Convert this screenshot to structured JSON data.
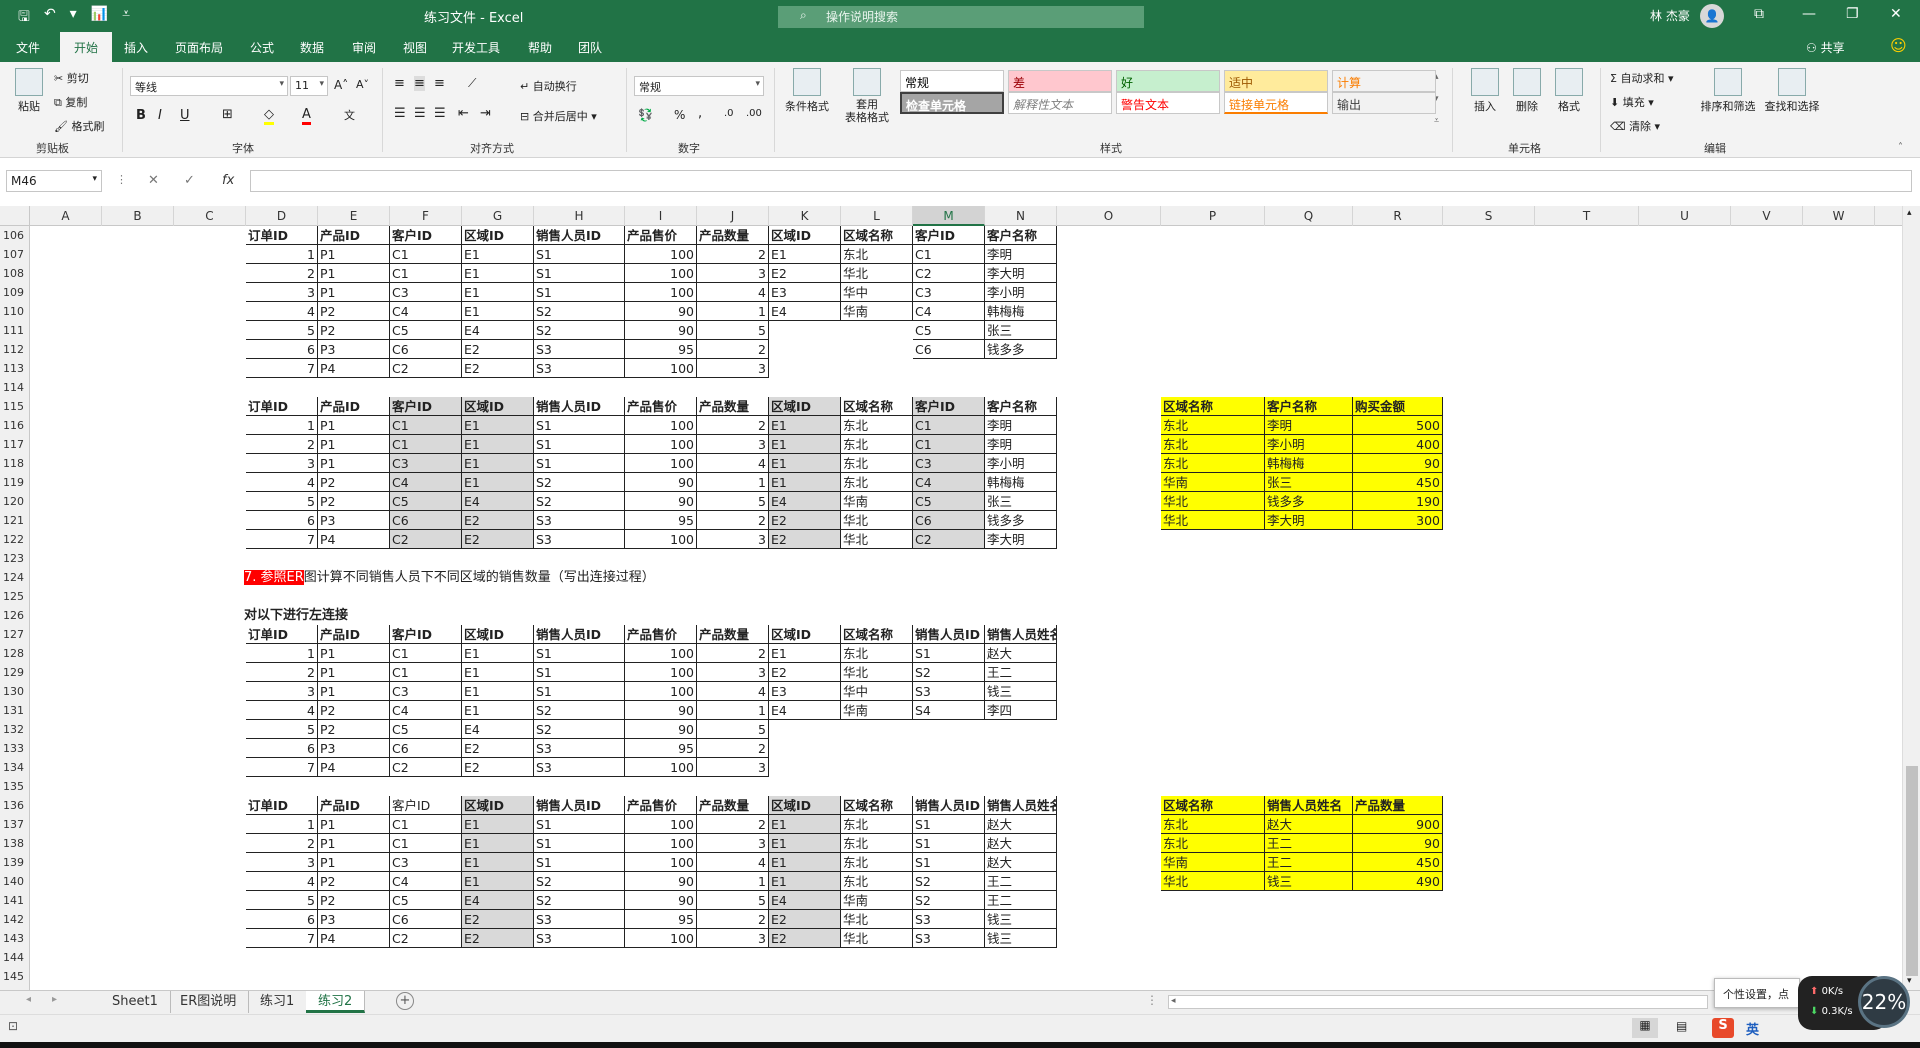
{
  "titlebar": {
    "doc_title": "练习文件 - Excel",
    "search_placeholder": "操作说明搜索",
    "user": "林 杰豪",
    "avatar_glyph": "👤",
    "qat": {
      "save": "🖫",
      "undo": "↶",
      "dropdown": "▾",
      "chart": "📊",
      "customize": "⩡"
    },
    "controls": {
      "ribbon_opts": "⧉",
      "minimize": "—",
      "restore": "❐",
      "close": "✕"
    }
  },
  "menu": {
    "tabs": [
      "文件",
      "开始",
      "插入",
      "页面布局",
      "公式",
      "数据",
      "审阅",
      "视图",
      "开发工具",
      "帮助",
      "团队"
    ],
    "active": "开始",
    "share": "共享",
    "smiley": "☺"
  },
  "ribbon": {
    "clipboard": {
      "paste": "粘贴",
      "cut": "剪切",
      "copy": "复制",
      "format_painter": "格式刷",
      "label": "剪贴板"
    },
    "font": {
      "name": "等线",
      "size": "11",
      "grow": "A˄",
      "shrink": "A˅",
      "bold": "B",
      "italic": "I",
      "underline": "U",
      "label": "字体"
    },
    "alignment": {
      "wrap": "自动换行",
      "merge": "合并后居中",
      "label": "对齐方式"
    },
    "number": {
      "format": "常规",
      "percent": "%",
      "comma": ",",
      "label": "数字"
    },
    "styles": {
      "cond_format": "条件格式",
      "table_format": "套用\n表格格式",
      "cells": [
        {
          "text": "常规",
          "bg": "#ffffff",
          "color": "#000000"
        },
        {
          "text": "差",
          "bg": "#ffc7ce",
          "color": "#9c0006"
        },
        {
          "text": "好",
          "bg": "#c6efce",
          "color": "#006100"
        },
        {
          "text": "适中",
          "bg": "#ffeb9c",
          "color": "#9c5700"
        },
        {
          "text": "计算",
          "bg": "#f2f2f2",
          "color": "#fa7d00"
        },
        {
          "text": "检查单元格",
          "bg": "#a5a5a5",
          "color": "#ffffff"
        },
        {
          "text": "解释性文本",
          "bg": "#ffffff",
          "color": "#7f7f7f"
        },
        {
          "text": "警告文本",
          "bg": "#ffffff",
          "color": "#ff0000"
        },
        {
          "text": "链接单元格",
          "bg": "#ffffff",
          "color": "#fa7d00"
        },
        {
          "text": "输出",
          "bg": "#f2f2f2",
          "color": "#3f3f3f"
        }
      ],
      "label": "样式"
    },
    "cells": {
      "insert": "插入",
      "delete": "删除",
      "format": "格式",
      "label": "单元格"
    },
    "editing": {
      "autosum": "自动求和",
      "fill": "填充",
      "clear": "清除",
      "sort": "排序和筛选",
      "find": "查找和选择",
      "label": "编辑"
    }
  },
  "formula_bar": {
    "name_box": "M46",
    "fx": "fx",
    "cancel": "✕",
    "enter": "✓",
    "value": ""
  },
  "columns": [
    "A",
    "B",
    "C",
    "D",
    "E",
    "F",
    "G",
    "H",
    "I",
    "J",
    "K",
    "L",
    "M",
    "N",
    "O",
    "P",
    "Q",
    "R",
    "S",
    "T",
    "U",
    "V",
    "W"
  ],
  "selected_column": "M",
  "rows_start": 106,
  "rows_end": 145,
  "sheet": {
    "t1_header": [
      "订单ID",
      "产品ID",
      "客户ID",
      "区域ID",
      "销售人员ID",
      "产品售价",
      "产品数量"
    ],
    "t1_rows": [
      [
        "1",
        "P1",
        "C1",
        "E1",
        "S1",
        "100",
        "2"
      ],
      [
        "2",
        "P1",
        "C1",
        "E1",
        "S1",
        "100",
        "3"
      ],
      [
        "3",
        "P1",
        "C3",
        "E1",
        "S1",
        "100",
        "4"
      ],
      [
        "4",
        "P2",
        "C4",
        "E1",
        "S2",
        "90",
        "1"
      ],
      [
        "5",
        "P2",
        "C5",
        "E4",
        "S2",
        "90",
        "5"
      ],
      [
        "6",
        "P3",
        "C6",
        "E2",
        "S3",
        "95",
        "2"
      ],
      [
        "7",
        "P4",
        "C2",
        "E2",
        "S3",
        "100",
        "3"
      ]
    ],
    "region_header": [
      "区域ID",
      "区域名称"
    ],
    "region_rows": [
      [
        "E1",
        "东北"
      ],
      [
        "E2",
        "华北"
      ],
      [
        "E3",
        "华中"
      ],
      [
        "E4",
        "华南"
      ]
    ],
    "customer_header": [
      "客户ID",
      "客户名称"
    ],
    "customer_rows": [
      [
        "C1",
        "李明"
      ],
      [
        "C2",
        "李大明"
      ],
      [
        "C3",
        "李小明"
      ],
      [
        "C4",
        "韩梅梅"
      ],
      [
        "C5",
        "张三"
      ],
      [
        "C6",
        "钱多多"
      ]
    ],
    "t2_header": [
      "订单ID",
      "产品ID",
      "客户ID",
      "区域ID",
      "销售人员ID",
      "产品售价",
      "产品数量",
      "区域ID",
      "区域名称",
      "客户ID",
      "客户名称"
    ],
    "t2_rows": [
      [
        "1",
        "P1",
        "C1",
        "E1",
        "S1",
        "100",
        "2",
        "E1",
        "东北",
        "C1",
        "李明"
      ],
      [
        "2",
        "P1",
        "C1",
        "E1",
        "S1",
        "100",
        "3",
        "E1",
        "东北",
        "C1",
        "李明"
      ],
      [
        "3",
        "P1",
        "C3",
        "E1",
        "S1",
        "100",
        "4",
        "E1",
        "东北",
        "C3",
        "李小明"
      ],
      [
        "4",
        "P2",
        "C4",
        "E1",
        "S2",
        "90",
        "1",
        "E1",
        "东北",
        "C4",
        "韩梅梅"
      ],
      [
        "5",
        "P2",
        "C5",
        "E4",
        "S2",
        "90",
        "5",
        "E4",
        "华南",
        "C5",
        "张三"
      ],
      [
        "6",
        "P3",
        "C6",
        "E2",
        "S3",
        "95",
        "2",
        "E2",
        "华北",
        "C6",
        "钱多多"
      ],
      [
        "7",
        "P4",
        "C2",
        "E2",
        "S3",
        "100",
        "3",
        "E2",
        "华北",
        "C2",
        "李大明"
      ]
    ],
    "sum1_header": [
      "区域名称",
      "客户名称",
      "购买金额"
    ],
    "sum1_rows": [
      [
        "东北",
        "李明",
        "500"
      ],
      [
        "东北",
        "李小明",
        "400"
      ],
      [
        "东北",
        "韩梅梅",
        "90"
      ],
      [
        "华南",
        "张三",
        "450"
      ],
      [
        "华北",
        "钱多多",
        "190"
      ],
      [
        "华北",
        "李大明",
        "300"
      ]
    ],
    "q7_tag": "7. 参照ER",
    "q7_text": "图计算不同销售人员下不同区域的销售数量（写出连接过程）",
    "left_join_note": "对以下进行左连接",
    "t3_header": [
      "订单ID",
      "产品ID",
      "客户ID",
      "区域ID",
      "销售人员ID",
      "产品售价",
      "产品数量",
      "区域ID",
      "区域名称",
      "销售人员ID",
      "销售人员姓名"
    ],
    "t3_region_rows": [
      [
        "E1",
        "东北",
        "S1",
        "赵大"
      ],
      [
        "E2",
        "华北",
        "S2",
        "王二"
      ],
      [
        "E3",
        "华中",
        "S3",
        "钱三"
      ],
      [
        "E4",
        "华南",
        "S4",
        "李四"
      ]
    ],
    "t4_rows": [
      [
        "1",
        "P1",
        "C1",
        "E1",
        "S1",
        "100",
        "2",
        "E1",
        "东北",
        "S1",
        "赵大"
      ],
      [
        "2",
        "P1",
        "C1",
        "E1",
        "S1",
        "100",
        "3",
        "E1",
        "东北",
        "S1",
        "赵大"
      ],
      [
        "3",
        "P1",
        "C3",
        "E1",
        "S1",
        "100",
        "4",
        "E1",
        "东北",
        "S1",
        "赵大"
      ],
      [
        "4",
        "P2",
        "C4",
        "E1",
        "S2",
        "90",
        "1",
        "E1",
        "东北",
        "S2",
        "王二"
      ],
      [
        "5",
        "P2",
        "C5",
        "E4",
        "S2",
        "90",
        "5",
        "E4",
        "华南",
        "S2",
        "王二"
      ],
      [
        "6",
        "P3",
        "C6",
        "E2",
        "S3",
        "95",
        "2",
        "E2",
        "华北",
        "S3",
        "钱三"
      ],
      [
        "7",
        "P4",
        "C2",
        "E2",
        "S3",
        "100",
        "3",
        "E2",
        "华北",
        "S3",
        "钱三"
      ]
    ],
    "sum2_header": [
      "区域名称",
      "销售人员姓名",
      "产品数量"
    ],
    "sum2_rows": [
      [
        "东北",
        "赵大",
        "900"
      ],
      [
        "东北",
        "王二",
        "90"
      ],
      [
        "华南",
        "王二",
        "450"
      ],
      [
        "华北",
        "钱三",
        "490"
      ]
    ]
  },
  "sheet_tabs": [
    "Sheet1",
    "ER图说明",
    "练习1",
    "练习2"
  ],
  "active_sheet": "练习2",
  "add_sheet": "+",
  "overlay": {
    "tip": "个性设置，点",
    "up_speed": "0K/s",
    "down_speed": "0.3K/s",
    "gauge": "22%"
  },
  "ime": {
    "logo": "S",
    "lang": "英"
  }
}
